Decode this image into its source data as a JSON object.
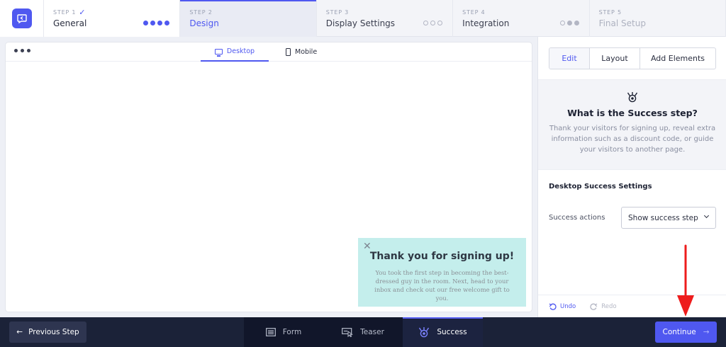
{
  "steps": [
    {
      "num": "STEP 1",
      "check": "✓",
      "name": "General",
      "state": "done"
    },
    {
      "num": "STEP 2",
      "name": "Design",
      "state": "active"
    },
    {
      "num": "STEP 3",
      "name": "Display Settings",
      "state": "future"
    },
    {
      "num": "STEP 4",
      "name": "Integration",
      "state": "future"
    },
    {
      "num": "STEP 5",
      "name": "Final Setup",
      "state": "disabled"
    }
  ],
  "preview": {
    "device_tabs": {
      "desktop": "Desktop",
      "mobile": "Mobile"
    },
    "popup": {
      "close": "✕",
      "title": "Thank you for signing up!",
      "body": "You took the first step in becoming the best-dressed guy in the room. Next, head to your inbox and check out our free welcome gift to you."
    }
  },
  "sidebar": {
    "tabs": {
      "edit": "Edit",
      "layout": "Layout",
      "add": "Add Elements"
    },
    "info": {
      "title": "What is the Success step?",
      "text": "Thank your visitors for signing up, reveal extra information such as a discount code, or guide your visitors to another page."
    },
    "settings_title": "Desktop Success Settings",
    "success_actions_label": "Success actions",
    "success_actions_value": "Show success step",
    "undo": "Undo",
    "redo": "Redo"
  },
  "bottom": {
    "prev": "Previous Step",
    "tabs": {
      "form": "Form",
      "teaser": "Teaser",
      "success": "Success"
    },
    "continue": "Continue"
  },
  "colors": {
    "accent": "#4f58f0",
    "popup_bg": "#c4eeec",
    "bottom_bar": "#1b2238",
    "annotation_arrow": "#ee1c1c"
  }
}
